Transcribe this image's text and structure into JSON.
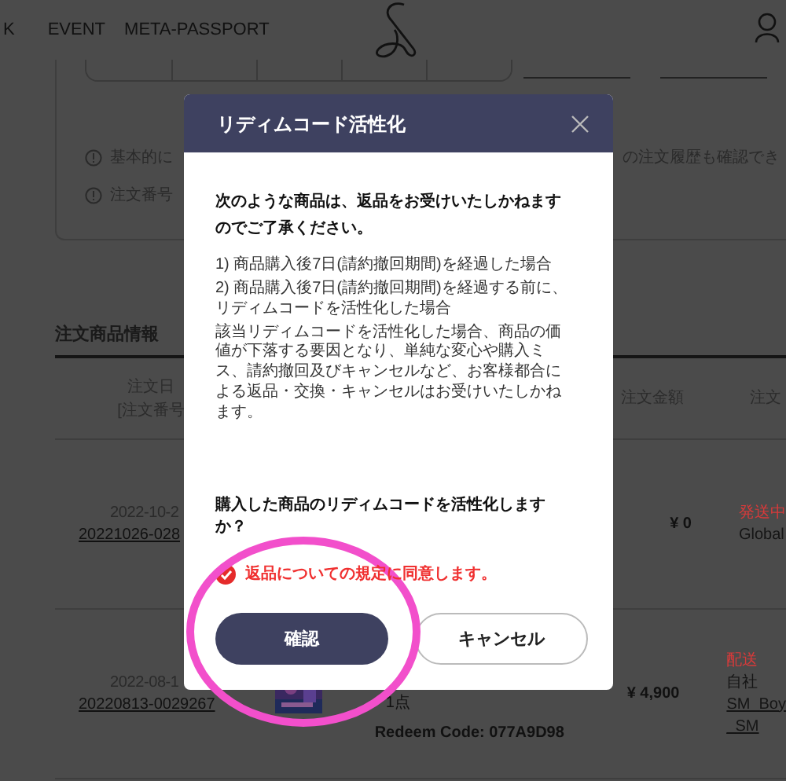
{
  "nav": {
    "items": [
      "K",
      "EVENT",
      "META-PASSPORT"
    ]
  },
  "filters": {
    "periods": [
      {
        "selected": false
      },
      {
        "selected": false
      },
      {
        "selected": false
      },
      {
        "selected": false
      },
      {
        "selected": false
      }
    ]
  },
  "notices": [
    {
      "left": "基本的に",
      "right": "の注文履歴も確認でき"
    },
    {
      "left": "注文番号"
    }
  ],
  "section_title": "注文商品情報",
  "columns": [
    {
      "label": "注文日",
      "sub": "[注文番号"
    },
    {
      "label": "注文金額"
    },
    {
      "label": "注文"
    }
  ],
  "rows": [
    {
      "date": "2022-10-2",
      "order_no": "20221026-028",
      "has_thumbnail": false,
      "amount": "¥ 0",
      "status": "発送中",
      "details": [
        "Global"
      ]
    },
    {
      "date": "2022-08-1",
      "order_no": "20220813-0029267",
      "has_thumbnail": true,
      "quantity": "1点",
      "code": "Redeem Code: 077A9D98",
      "amount": "¥ 4,900",
      "status": "配送",
      "details": [
        "自社",
        "SM_Boy",
        "_SM"
      ]
    }
  ],
  "dialog": {
    "title": "リディムコード活性化",
    "intro": "次のような商品は、返品をお受けいたしかねますのでご了承ください。",
    "cases": [
      "1) 商品購入後7日(請約撤回期間)を経過した場合",
      "2) 商品購入後7日(請約撤回期間)を経過する前に、リディムコードを活性化した場合"
    ],
    "note": "該当リディムコードを活性化した場合、商品の価値が下落する要因となり、単純な変心や購入ミス、請約撤回及びキャンセルなど、お客様都合による返品・交換・キャンセルはお受けいたしかねます。",
    "question": "購入した商品のリディムコードを活性化しますか？",
    "agree": {
      "label": "返品についての規定に同意します。",
      "checked": true
    },
    "buttons": [
      {
        "label": "確認",
        "kind": "primary"
      },
      {
        "label": "キャンセル",
        "kind": "secondary"
      }
    ]
  }
}
